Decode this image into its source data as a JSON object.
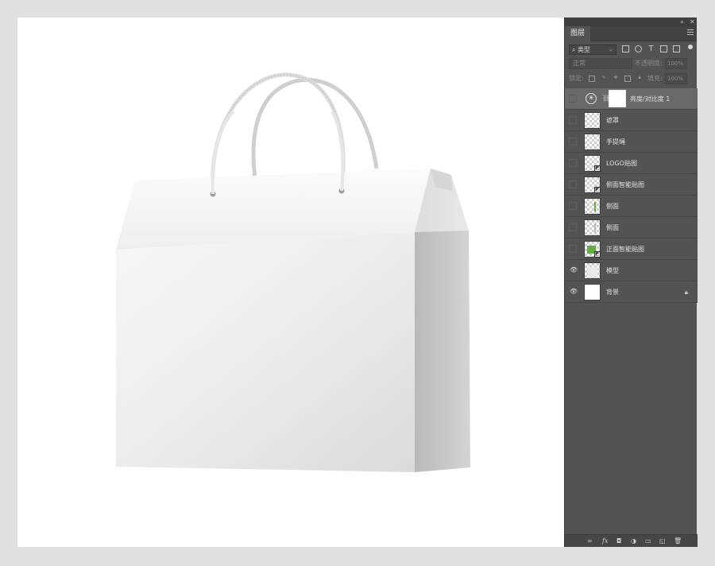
{
  "app": {
    "panel_controls": {
      "collapse": "«",
      "close": "✕"
    },
    "panel_menu_icon": "hamburger-menu-icon"
  },
  "layers_panel": {
    "tab_label": "图层",
    "filter": {
      "kind_label": "类型",
      "search_icon": "magnifier",
      "kind_icons": [
        "image-filter-icon",
        "adjustment-filter-icon",
        "type-filter-icon",
        "shape-filter-icon",
        "smart-object-filter-icon"
      ],
      "type_icon_glyph": "T"
    },
    "blend": {
      "mode": "正常",
      "opacity_label": "不透明度:",
      "opacity_value": "100%"
    },
    "lock": {
      "label": "锁定:",
      "fill_label": "填充:",
      "fill_value": "100%"
    },
    "layers": [
      {
        "name": "亮度/对比度 1",
        "type": "adjustment",
        "visible": false,
        "selected": true
      },
      {
        "name": "遮罩",
        "type": "pixel",
        "visible": false
      },
      {
        "name": "手提绳",
        "type": "pixel",
        "visible": false
      },
      {
        "name": "LOGO贴图",
        "type": "smart-object",
        "visible": false
      },
      {
        "name": "侧面智能贴图",
        "type": "smart-object",
        "visible": false
      },
      {
        "name": "侧面",
        "type": "pixel-green",
        "visible": false
      },
      {
        "name": "侧面",
        "type": "pixel",
        "visible": false
      },
      {
        "name": "正面智能贴图",
        "type": "smart-object-green",
        "visible": false
      },
      {
        "name": "模型",
        "type": "pixel",
        "visible": true
      },
      {
        "name": "背景",
        "type": "background",
        "visible": true,
        "locked": true
      }
    ],
    "bottom_icons": [
      "link-layers-icon",
      "fx-icon",
      "add-mask-icon",
      "adjustment-layer-icon",
      "new-group-icon",
      "new-layer-icon",
      "delete-layer-icon"
    ],
    "fx_label": "fx"
  },
  "colors": {
    "panel_bg": "#535353",
    "selected_row": "#696969",
    "canvas_bg": "#ffffff",
    "workspace_bg": "#e0e0e0",
    "green_accent": "#5fae3e"
  }
}
